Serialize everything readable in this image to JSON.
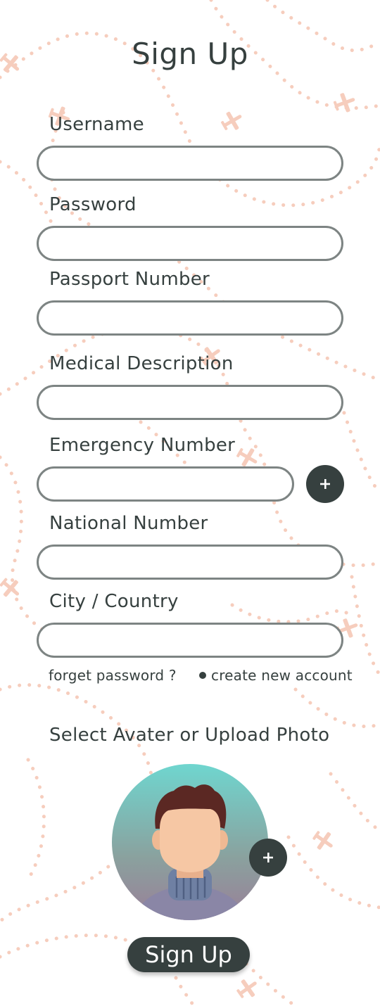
{
  "title": "Sign Up",
  "form": {
    "fields": [
      {
        "label": "Username",
        "value": ""
      },
      {
        "label": "Password",
        "value": ""
      },
      {
        "label": "Passport Number",
        "value": ""
      },
      {
        "label": "Medical Description",
        "value": ""
      },
      {
        "label": "Emergency Number",
        "value": ""
      },
      {
        "label": "National Number",
        "value": ""
      },
      {
        "label": "City / Country",
        "value": ""
      }
    ],
    "add_emergency_icon": "plus-icon"
  },
  "links": {
    "forget_password": "forget password ?",
    "create_account": "create new account"
  },
  "avatar": {
    "label": "Select Avater or Upload Photo",
    "add_photo_icon": "plus-icon"
  },
  "submit_label": "Sign Up",
  "colors": {
    "primary": "#36403f",
    "field_border": "#7d8483",
    "background_pattern": "#f6c9b7",
    "avatar_gradient_top": "#6fd6cf",
    "avatar_gradient_bottom": "#9a7f98"
  }
}
